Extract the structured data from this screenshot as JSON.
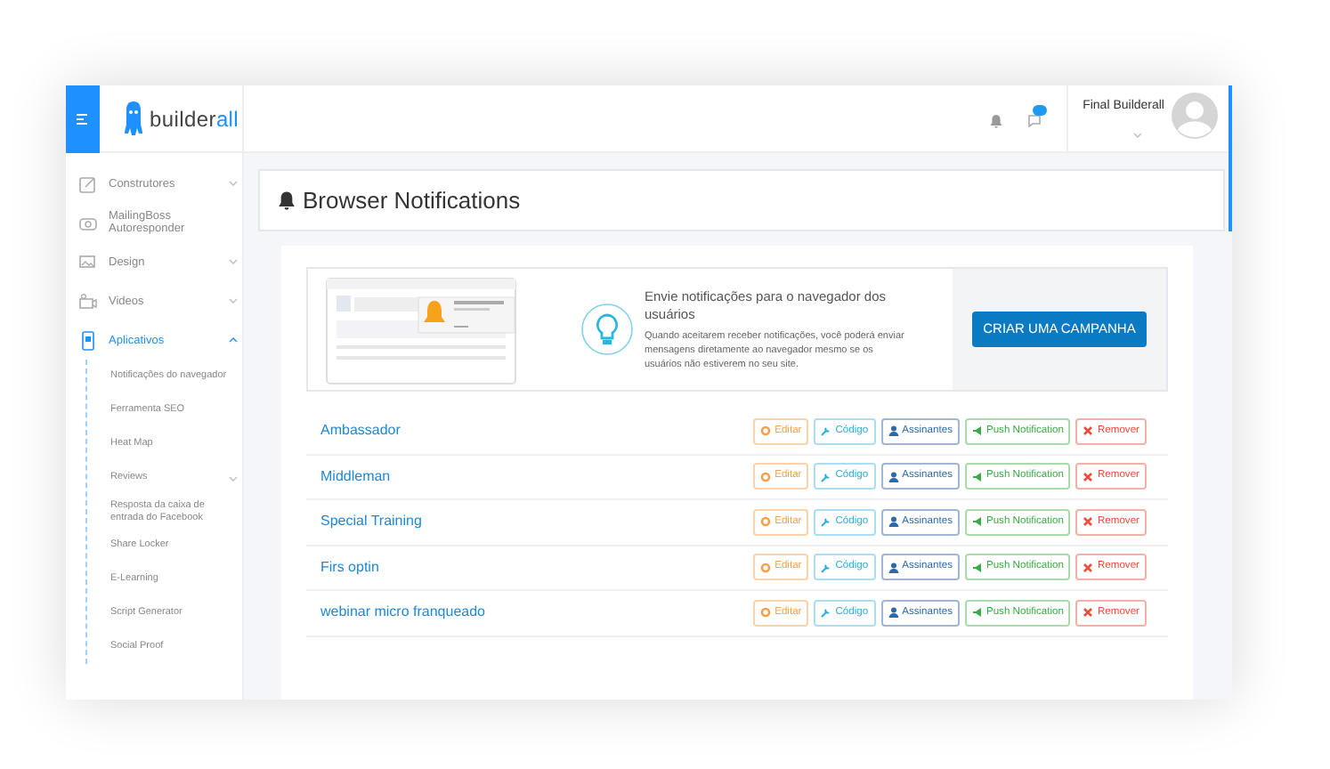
{
  "header": {
    "logo": {
      "prefix": "builder",
      "suffix": "all"
    },
    "user_name": "Final Builderall"
  },
  "sidebar": {
    "items": [
      {
        "label": "Construtores",
        "selected": false,
        "expanded": false
      },
      {
        "label": "MailingBoss Autoresponder",
        "selected": false
      },
      {
        "label": "Design",
        "selected": false,
        "expanded": false
      },
      {
        "label": "Videos",
        "selected": false,
        "expanded": false
      },
      {
        "label": "Aplicativos",
        "selected": true,
        "expanded": true,
        "children": [
          {
            "label": "Notificações do navegador"
          },
          {
            "label": "Ferramenta SEO"
          },
          {
            "label": "Heat Map"
          },
          {
            "label": "Reviews",
            "expanded": false
          },
          {
            "label": "Resposta da caixa de entrada do Facebook"
          },
          {
            "label": "Share Locker"
          },
          {
            "label": "E-Learning"
          },
          {
            "label": "Script Generator"
          },
          {
            "label": "Social Proof"
          }
        ]
      }
    ]
  },
  "page_title": "Browser Notifications",
  "banner": {
    "heading": "Envie notificações para o navegador dos usuários",
    "body": "Quando aceitarem receber notificações, você poderá enviar mensagens diretamente ao navegador mesmo se os usuários não estiverem no seu site.",
    "button": "CRIAR UMA CAMPANHA"
  },
  "rows": [
    {
      "name": "Ambassador",
      "actions": [
        {
          "kind": "edit",
          "label": "Editar"
        },
        {
          "kind": "code",
          "label": "Código"
        },
        {
          "kind": "subscribers",
          "label": "Assinantes"
        },
        {
          "kind": "push",
          "label": "Push Notification"
        },
        {
          "kind": "remove",
          "label": "Remover"
        }
      ]
    },
    {
      "name": "Middleman",
      "actions": [
        {
          "kind": "edit",
          "label": "Editar"
        },
        {
          "kind": "code",
          "label": "Código"
        },
        {
          "kind": "subscribers",
          "label": "Assinantes"
        },
        {
          "kind": "push",
          "label": "Push Notification"
        },
        {
          "kind": "remove",
          "label": "Remover"
        }
      ]
    },
    {
      "name": "Special Training",
      "actions": [
        {
          "kind": "edit",
          "label": "Editar"
        },
        {
          "kind": "code",
          "label": "Código"
        },
        {
          "kind": "subscribers",
          "label": "Assinantes"
        },
        {
          "kind": "push",
          "label": "Push Notification"
        },
        {
          "kind": "remove",
          "label": "Remover"
        }
      ]
    },
    {
      "name": "Firs optin",
      "actions": [
        {
          "kind": "edit",
          "label": "Editar"
        },
        {
          "kind": "code",
          "label": "Código"
        },
        {
          "kind": "subscribers",
          "label": "Assinantes"
        },
        {
          "kind": "push",
          "label": "Push Notification"
        },
        {
          "kind": "remove",
          "label": "Remover"
        }
      ]
    },
    {
      "name": "webinar micro franqueado",
      "actions": [
        {
          "kind": "edit",
          "label": "Editar"
        },
        {
          "kind": "code",
          "label": "Código"
        },
        {
          "kind": "subscribers",
          "label": "Assinantes"
        },
        {
          "kind": "push",
          "label": "Push Notification"
        },
        {
          "kind": "remove",
          "label": "Remover"
        }
      ]
    }
  ]
}
